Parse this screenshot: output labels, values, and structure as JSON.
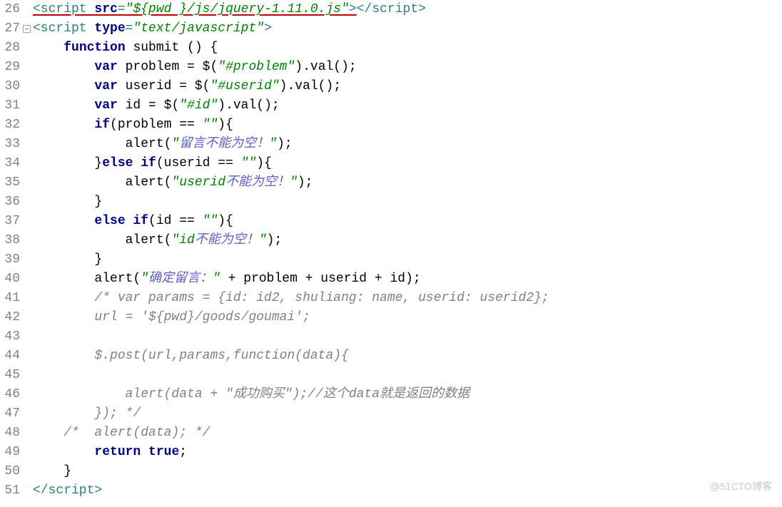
{
  "gutter": {
    "start": 26,
    "end": 51
  },
  "fold_markers": [
    27
  ],
  "watermark": "@51CTO博客",
  "lines": {
    "26": [
      {
        "cls": "t-tag t-underline",
        "txt": "<script "
      },
      {
        "cls": "t-kw t-underline",
        "txt": "src"
      },
      {
        "cls": "t-tag t-underline",
        "txt": "="
      },
      {
        "cls": "t-str t-underline",
        "txt": "\"${pwd }"
      },
      {
        "cls": "t-str t-underline",
        "txt": "/js/jquery-1.11.0.js\""
      },
      {
        "cls": "t-tag t-underline",
        "txt": ">"
      },
      {
        "cls": "t-tag",
        "txt": "</script>"
      }
    ],
    "27": [
      {
        "cls": "t-tag",
        "txt": "<script "
      },
      {
        "cls": "t-kw",
        "txt": "type"
      },
      {
        "cls": "t-tag",
        "txt": "="
      },
      {
        "cls": "t-str",
        "txt": "\"text/javascript\""
      },
      {
        "cls": "t-tag",
        "txt": ">"
      }
    ],
    "28": [
      {
        "cls": "",
        "txt": "    "
      },
      {
        "cls": "t-kw",
        "txt": "function"
      },
      {
        "cls": "",
        "txt": " submit () {"
      }
    ],
    "29": [
      {
        "cls": "",
        "txt": "        "
      },
      {
        "cls": "t-kw",
        "txt": "var"
      },
      {
        "cls": "",
        "txt": " problem = $("
      },
      {
        "cls": "t-str",
        "txt": "\"#problem\""
      },
      {
        "cls": "",
        "txt": ").val();"
      }
    ],
    "30": [
      {
        "cls": "",
        "txt": "        "
      },
      {
        "cls": "t-kw",
        "txt": "var"
      },
      {
        "cls": "",
        "txt": " userid = $("
      },
      {
        "cls": "t-str",
        "txt": "\"#userid\""
      },
      {
        "cls": "",
        "txt": ").val();"
      }
    ],
    "31": [
      {
        "cls": "",
        "txt": "        "
      },
      {
        "cls": "t-kw",
        "txt": "var"
      },
      {
        "cls": "",
        "txt": " id = $("
      },
      {
        "cls": "t-str",
        "txt": "\"#id\""
      },
      {
        "cls": "",
        "txt": ").val();"
      }
    ],
    "32": [
      {
        "cls": "",
        "txt": "        "
      },
      {
        "cls": "t-kw",
        "txt": "if"
      },
      {
        "cls": "",
        "txt": "(problem == "
      },
      {
        "cls": "t-str",
        "txt": "\"\""
      },
      {
        "cls": "",
        "txt": "){"
      }
    ],
    "33": [
      {
        "cls": "",
        "txt": "            alert("
      },
      {
        "cls": "t-str",
        "txt": "\""
      },
      {
        "cls": "t-str-cjk",
        "txt": "留言不能为空！"
      },
      {
        "cls": "t-str",
        "txt": "\""
      },
      {
        "cls": "",
        "txt": ");"
      }
    ],
    "34": [
      {
        "cls": "",
        "txt": "        }"
      },
      {
        "cls": "t-kw",
        "txt": "else if"
      },
      {
        "cls": "",
        "txt": "(userid == "
      },
      {
        "cls": "t-str",
        "txt": "\"\""
      },
      {
        "cls": "",
        "txt": "){"
      }
    ],
    "35": [
      {
        "cls": "",
        "txt": "            alert("
      },
      {
        "cls": "t-str",
        "txt": "\"userid"
      },
      {
        "cls": "t-str-cjk",
        "txt": "不能为空！"
      },
      {
        "cls": "t-str",
        "txt": "\""
      },
      {
        "cls": "",
        "txt": ");"
      }
    ],
    "36": [
      {
        "cls": "",
        "txt": "        }"
      }
    ],
    "37": [
      {
        "cls": "",
        "txt": "        "
      },
      {
        "cls": "t-kw",
        "txt": "else if"
      },
      {
        "cls": "",
        "txt": "(id == "
      },
      {
        "cls": "t-str",
        "txt": "\"\""
      },
      {
        "cls": "",
        "txt": "){"
      }
    ],
    "38": [
      {
        "cls": "",
        "txt": "            alert("
      },
      {
        "cls": "t-str",
        "txt": "\"id"
      },
      {
        "cls": "t-str-cjk",
        "txt": "不能为空！"
      },
      {
        "cls": "t-str",
        "txt": "\""
      },
      {
        "cls": "",
        "txt": ");"
      }
    ],
    "39": [
      {
        "cls": "",
        "txt": "        }"
      }
    ],
    "40": [
      {
        "cls": "",
        "txt": "        alert("
      },
      {
        "cls": "t-str",
        "txt": "\""
      },
      {
        "cls": "t-str-cjk",
        "txt": "确定留言："
      },
      {
        "cls": "t-str",
        "txt": "\""
      },
      {
        "cls": "",
        "txt": " + problem + userid + id);"
      }
    ],
    "41": [
      {
        "cls": "",
        "txt": "        "
      },
      {
        "cls": "t-cmt",
        "txt": "/* var params = {id: id2, shuliang: name, userid: userid2};"
      }
    ],
    "42": [
      {
        "cls": "t-cmt",
        "txt": "        url = '${pwd}/goods/goumai';"
      }
    ],
    "43": [
      {
        "cls": "t-cmt",
        "txt": ""
      }
    ],
    "44": [
      {
        "cls": "t-cmt",
        "txt": "        $.post(url,params,function(data){"
      }
    ],
    "45": [
      {
        "cls": "t-cmt",
        "txt": ""
      }
    ],
    "46": [
      {
        "cls": "t-cmt",
        "txt": "            alert(data + \""
      },
      {
        "cls": "t-cmt",
        "txt": "成功购买"
      },
      {
        "cls": "t-cmt",
        "txt": "\");//这个data就是返回的数据"
      }
    ],
    "47": [
      {
        "cls": "t-cmt",
        "txt": "        }); */"
      }
    ],
    "48": [
      {
        "cls": "",
        "txt": "    "
      },
      {
        "cls": "t-cmt",
        "txt": "/*  alert(data); */"
      }
    ],
    "49": [
      {
        "cls": "",
        "txt": "        "
      },
      {
        "cls": "t-kw",
        "txt": "return true"
      },
      {
        "cls": "",
        "txt": ";"
      }
    ],
    "50": [
      {
        "cls": "",
        "txt": "    }"
      }
    ],
    "51": [
      {
        "cls": "t-tag",
        "txt": "</script>"
      }
    ]
  }
}
